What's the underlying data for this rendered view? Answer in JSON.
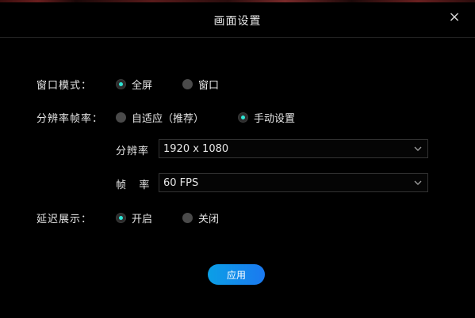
{
  "dialog": {
    "title": "画面设置",
    "close_glyph": "×"
  },
  "window_mode": {
    "label": "窗口模式：",
    "options": [
      {
        "label": "全屏",
        "checked": true
      },
      {
        "label": "窗口",
        "checked": false
      }
    ]
  },
  "resolution_framerate": {
    "label": "分辨率帧率：",
    "options": [
      {
        "label": "自适应（推荐）",
        "checked": false
      },
      {
        "label": "手动设置",
        "checked": true
      }
    ],
    "resolution": {
      "label": "分辨率",
      "value": "1920 x 1080"
    },
    "framerate": {
      "label": "帧   率",
      "value": "60 FPS"
    }
  },
  "delay_display": {
    "label": "延迟展示：",
    "options": [
      {
        "label": "开启",
        "checked": true
      },
      {
        "label": "关闭",
        "checked": false
      }
    ]
  },
  "apply_button": {
    "label": "应用"
  },
  "colors": {
    "accent": "#2ee6d6",
    "button_gradient_start": "#0b9fe6",
    "button_gradient_end": "#1b79f0",
    "background": "#000000"
  },
  "icons": {
    "close": "close-icon",
    "dropdown": "chevron-down-icon"
  }
}
